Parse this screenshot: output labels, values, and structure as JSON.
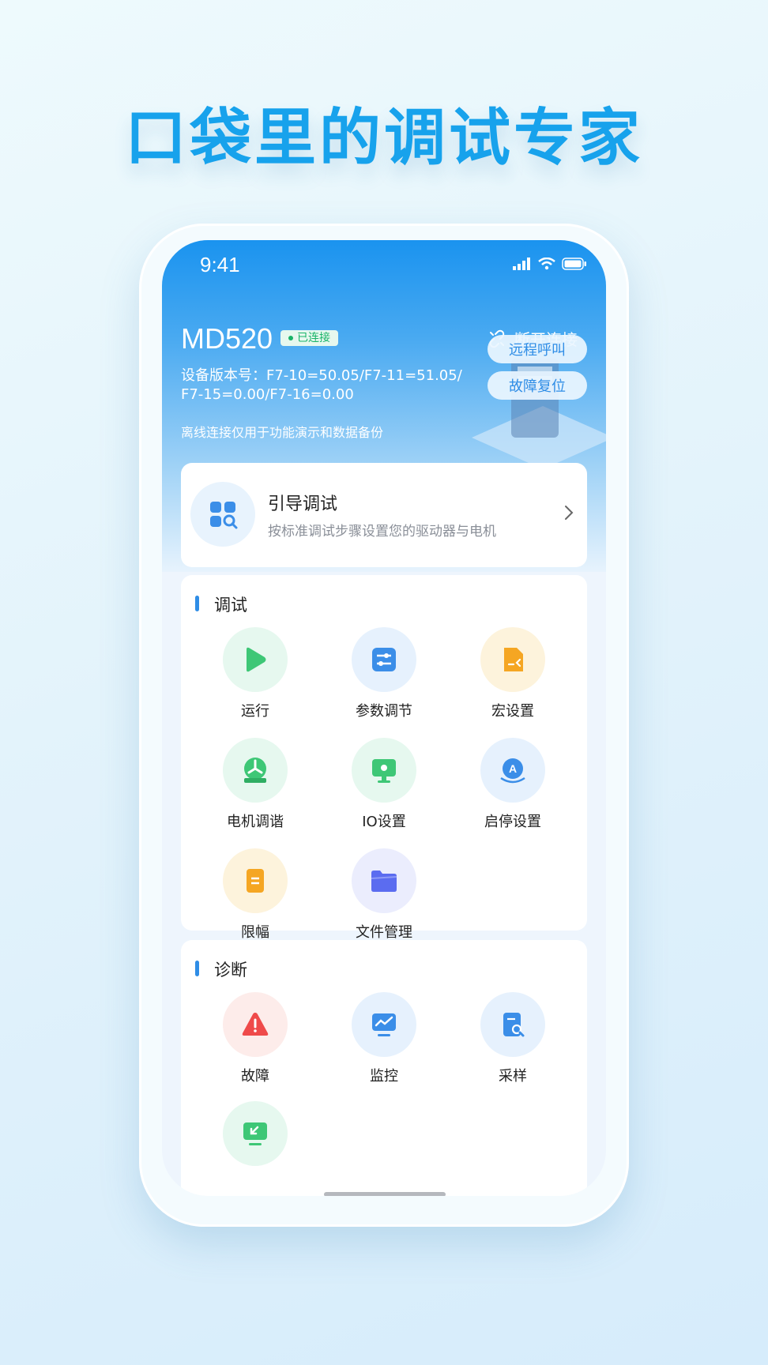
{
  "headline": "口袋里的调试专家",
  "status": {
    "time": "9:41"
  },
  "device": {
    "name": "MD520",
    "badge": "已连接",
    "disconnect": "断开连接",
    "version_line1": "设备版本号：F7-10=50.05/F7-11=51.05/",
    "version_line2": "F7-15=0.00/F7-16=0.00",
    "offline_note": "离线连接仅用于功能演示和数据备份",
    "remote_call": "远程呼叫",
    "fault_reset": "故障复位"
  },
  "guide": {
    "title": "引导调试",
    "subtitle": "按标准调试步骤设置您的驱动器与电机"
  },
  "debug": {
    "title": "调试",
    "items": [
      {
        "label": "运行",
        "icon": "play-icon"
      },
      {
        "label": "参数调节",
        "icon": "sliders-icon"
      },
      {
        "label": "宏设置",
        "icon": "macro-doc-icon"
      },
      {
        "label": "电机调谐",
        "icon": "motor-fan-icon"
      },
      {
        "label": "IO设置",
        "icon": "io-monitor-icon"
      },
      {
        "label": "启停设置",
        "icon": "start-stop-icon"
      },
      {
        "label": "限幅",
        "icon": "limit-icon"
      },
      {
        "label": "文件管理",
        "icon": "folder-icon"
      }
    ]
  },
  "diagnose": {
    "title": "诊断",
    "items": [
      {
        "label": "故障",
        "icon": "warning-icon"
      },
      {
        "label": "监控",
        "icon": "monitor-chart-icon"
      },
      {
        "label": "采样",
        "icon": "sample-doc-icon"
      },
      {
        "label": "",
        "icon": "remote-screen-icon"
      }
    ]
  },
  "colors": {
    "accent": "#2f8de6",
    "headline": "#17a2ec",
    "connected": "#19b368"
  }
}
